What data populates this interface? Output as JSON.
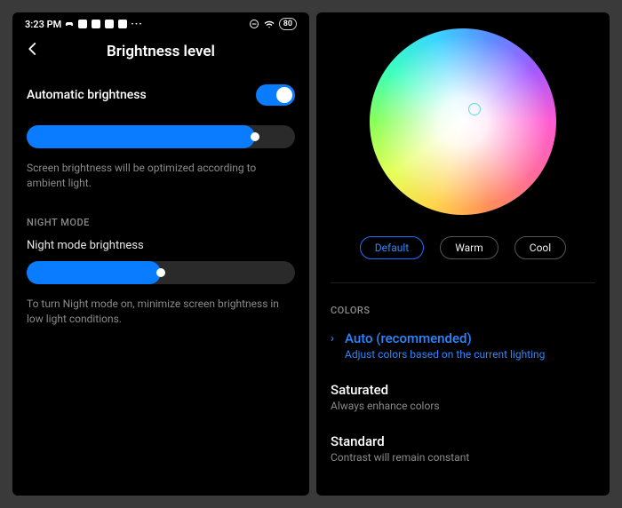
{
  "statusbar": {
    "time": "3:23 PM",
    "battery": "80"
  },
  "header": {
    "title": "Brightness level"
  },
  "auto_brightness": {
    "label": "Automatic brightness",
    "help": "Screen brightness will be optimized according to ambient light.",
    "slider_percent": 85
  },
  "night_mode": {
    "heading": "NIGHT MODE",
    "label": "Night mode brightness",
    "help": "To turn Night mode on, minimize screen brightness in low light conditions.",
    "slider_percent": 50
  },
  "color_temp": {
    "chips": {
      "default": "Default",
      "warm": "Warm",
      "cool": "Cool"
    }
  },
  "colors": {
    "heading": "COLORS",
    "auto": {
      "title": "Auto (recommended)",
      "desc": "Adjust colors based on the current lighting"
    },
    "saturated": {
      "title": "Saturated",
      "desc": "Always enhance colors"
    },
    "standard": {
      "title": "Standard",
      "desc": "Contrast will remain constant"
    }
  }
}
